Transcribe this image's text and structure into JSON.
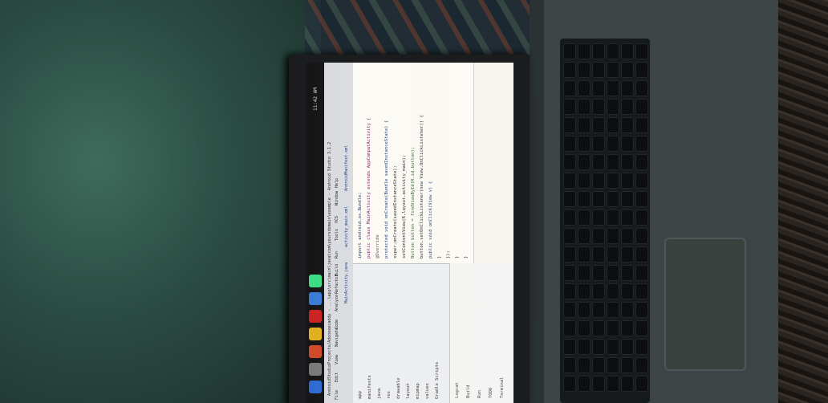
{
  "photo": {
    "subject": "laptop-on-floor",
    "screen_app": "IDE",
    "colors": {
      "wall": "#2b4c43",
      "laptop_body": "#3c4446",
      "keyboard": "#161a1c",
      "screen": "#f2eee5",
      "taskbar": "#151517"
    }
  },
  "screen": {
    "window_title": "AndroidStudioProjects/Adonexecaddy - ...\\app\\src\\main\\java\\com\\yoursdomain\\example - Android Studio 3.1.2",
    "menu": [
      "File",
      "Edit",
      "View",
      "Navigate",
      "Code",
      "Analyze",
      "Refactor",
      "Build",
      "Run",
      "Tools",
      "VCS",
      "Window",
      "Help"
    ],
    "tabs": [
      "MainActivity.java",
      "activity_main.xml",
      "AndroidManifest.xml"
    ],
    "code_lines": [
      "import android.os.Bundle;",
      "public class MainActivity extends AppCompatActivity {",
      "  @Override",
      "  protected void onCreate(Bundle savedInstanceState) {",
      "    super.onCreate(savedInstanceState);",
      "    setContentView(R.layout.activity_main);",
      "    Button button = findViewById(R.id.button);",
      "    button.setOnClickListener(new View.OnClickListener() {",
      "      public void onClick(View v) {",
      "      }",
      "    });",
      "  }",
      "}"
    ],
    "tree_items": [
      "app",
      "manifests",
      "java",
      "res",
      "drawable",
      "layout",
      "mipmap",
      "values",
      "Gradle Scripts"
    ],
    "bottom_panel": [
      "Logcat",
      "Build",
      "Run",
      "TODO",
      "Terminal"
    ],
    "clock": "11:42 AM"
  }
}
